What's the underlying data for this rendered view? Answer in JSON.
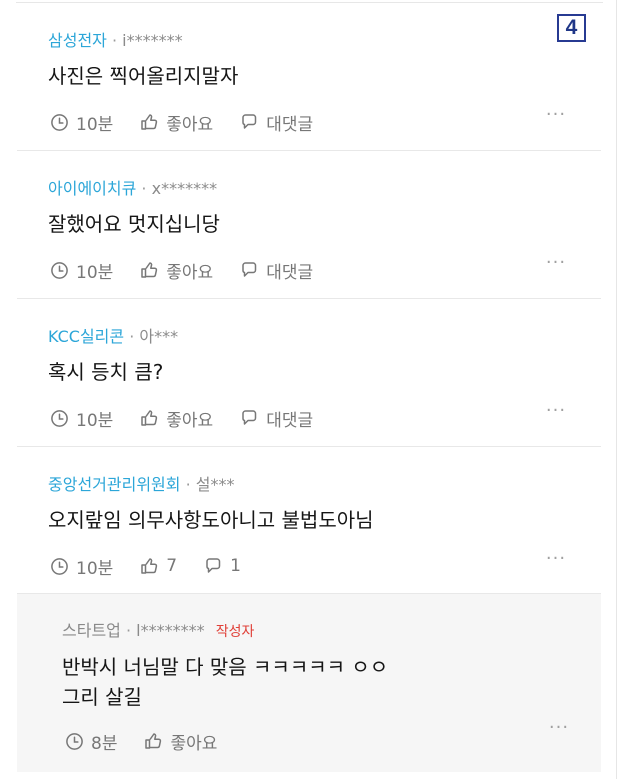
{
  "page_badge": "4",
  "comments": [
    {
      "author": "삼성전자",
      "separator": "·",
      "user": "i*******",
      "text": "사진은 찍어올리지말자",
      "time": "10분",
      "like": "좋아요",
      "reply": "대댓글",
      "more": "···"
    },
    {
      "author": "아이에이치큐",
      "separator": "·",
      "user": "x*******",
      "text": "잘했어요 멋지십니당",
      "time": "10분",
      "like": "좋아요",
      "reply": "대댓글",
      "more": "···"
    },
    {
      "author": "KCC실리콘",
      "separator": "·",
      "user": "아***",
      "text": "혹시 등치 큼?",
      "time": "10분",
      "like": "좋아요",
      "reply": "대댓글",
      "more": "···"
    },
    {
      "author": "중앙선거관리위원회",
      "separator": "·",
      "user": "설***",
      "text": "오지랖임 의무사항도아니고 불법도아님",
      "time": "10분",
      "like": "7",
      "reply": "1",
      "more": "···"
    }
  ],
  "reply": {
    "author": "스타트업",
    "separator": "·",
    "user": "l********",
    "badge": "작성자",
    "text": "반박시 너님말 다 맞음 ㅋㅋㅋㅋㅋ ㅇㅇ\n그리 살길",
    "time": "8분",
    "like": "좋아요",
    "more": "···"
  },
  "colors": {
    "author_accent": "#2ca6d8",
    "badge_border": "#273a92",
    "writer_badge": "#e04038",
    "reply_background": "#f6f6f6"
  },
  "icons": {
    "time": "clock-icon",
    "like": "thumbs-up-icon",
    "reply": "speech-bubble-icon",
    "more": "more-horizontal-icon"
  }
}
